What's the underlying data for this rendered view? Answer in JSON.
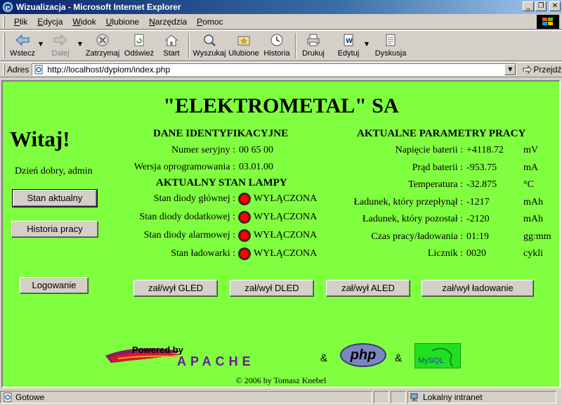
{
  "window": {
    "title": "Wizualizacja - Microsoft Internet Explorer",
    "min_glyph": "_",
    "max_glyph": "❐",
    "close_glyph": "✕"
  },
  "menu": {
    "items": [
      {
        "u": "P",
        "rest": "lik"
      },
      {
        "u": "E",
        "rest": "dycja"
      },
      {
        "u": "W",
        "rest": "idok"
      },
      {
        "u": "U",
        "rest": "lubione"
      },
      {
        "u": "N",
        "rest": "arzędzia"
      },
      {
        "u": "P",
        "rest": "omoc"
      }
    ]
  },
  "toolbar": {
    "back": "Wstecz",
    "forward": "Dalej",
    "stop": "Zatrzymaj",
    "refresh": "Odśwież",
    "home": "Start",
    "search": "Wyszukaj",
    "favorites": "Ulubione",
    "history": "Historia",
    "print": "Drukuj",
    "edit": "Edytuj",
    "discuss": "Dyskusja",
    "dropdown_glyph": "▼"
  },
  "address": {
    "label": "Adres",
    "url": "http://localhost/dyplom/index.php",
    "go": "Przejdź",
    "dropdown_glyph": "▼"
  },
  "page": {
    "title": "\"ELEKTROMETAL\" SA",
    "welcome": "Witaj!",
    "greeting": "Dzień dobry, admin",
    "nav": {
      "current_state": "Stan aktualny",
      "work_history": "Historia pracy",
      "logout": "Logowanie"
    },
    "ident": {
      "heading": "DANE IDENTYFIKACYJNE",
      "serial_label": "Numer seryjny :",
      "serial_value": "00 65 00",
      "software_label": "Wersja oprogramowania :",
      "software_value": "03.01.00"
    },
    "lamp": {
      "heading": "AKTUALNY STAN LAMPY",
      "rows": [
        {
          "label": "Stan diody głównej :",
          "state": "WYŁĄCZONA"
        },
        {
          "label": "Stan diody dodatkowej :",
          "state": "WYŁĄCZONA"
        },
        {
          "label": "Stan diody alarmowej :",
          "state": "WYŁĄCZONA"
        },
        {
          "label": "Stan ładowarki :",
          "state": "WYŁĄCZONA"
        }
      ],
      "led_color": "#ff0000"
    },
    "params": {
      "heading": "AKTUALNE PARAMETRY PRACY",
      "rows": [
        {
          "label": "Napięcie baterii :",
          "value": "+4118.72",
          "unit": "mV"
        },
        {
          "label": "Prąd baterii :",
          "value": "-953.75",
          "unit": "mA"
        },
        {
          "label": "Temperatura :",
          "value": "-32.875",
          "unit": "°C"
        },
        {
          "label": "Ładunek, który przepłynął :",
          "value": "-1217",
          "unit": "mAh"
        },
        {
          "label": "Ładunek, który pozostał :",
          "value": "-2120",
          "unit": "mAh"
        },
        {
          "label": "Czas pracy/ładowania :",
          "value": "01:19",
          "unit": "gg:mm"
        },
        {
          "label": "Licznik :",
          "value": "0020",
          "unit": "cykli"
        }
      ]
    },
    "actions": {
      "gled": "zał/wył GLED",
      "dled": "zał/wył DLED",
      "aled": "zał/wył ALED",
      "charging": "zał/wył ładowanie"
    },
    "logos": {
      "apache_powered": "Powered by",
      "apache_name": "APACHE",
      "php": "php",
      "mysql": "MySQL",
      "amp": "&"
    },
    "copyright": "© 2006 by Tomasz Knebel",
    "background": "#80ff40"
  },
  "status": {
    "text": "Gotowe",
    "zone": "Lokalny intranet"
  }
}
